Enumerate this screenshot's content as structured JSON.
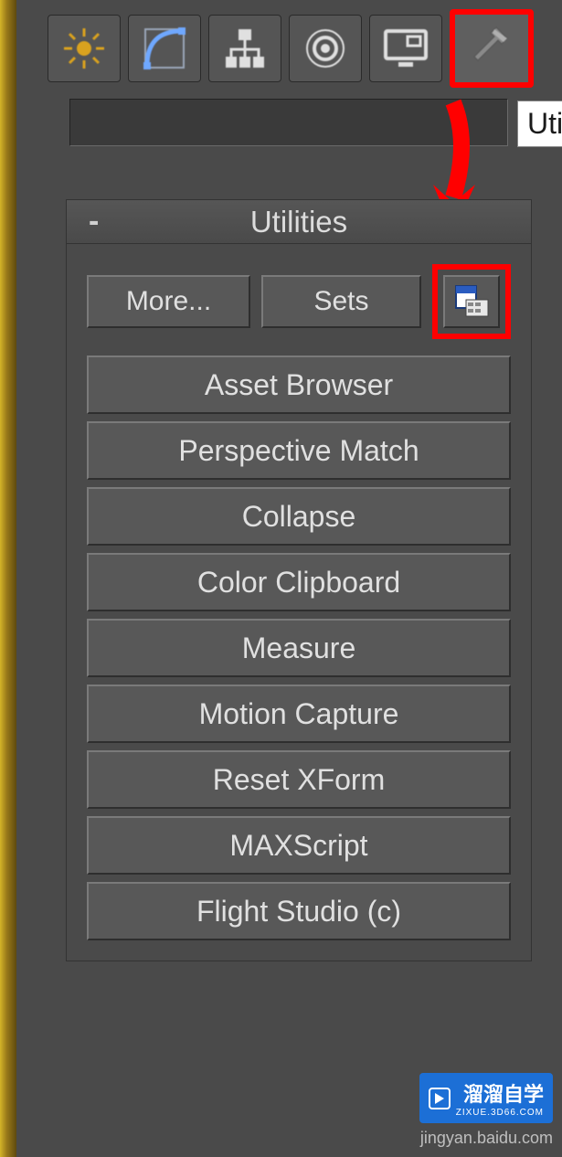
{
  "tabs": {
    "tooltip": "Uti"
  },
  "nameField": {
    "value": ""
  },
  "rollout": {
    "title": "Utilities",
    "more_label": "More...",
    "sets_label": "Sets"
  },
  "utilities": [
    "Asset Browser",
    "Perspective Match",
    "Collapse",
    "Color Clipboard",
    "Measure",
    "Motion Capture",
    "Reset XForm",
    "MAXScript",
    "Flight Studio (c)"
  ],
  "watermark": {
    "brand": "溜溜自学",
    "sub": "ZIXUE.3D66.COM",
    "domain": "jingyan.baidu.com"
  }
}
